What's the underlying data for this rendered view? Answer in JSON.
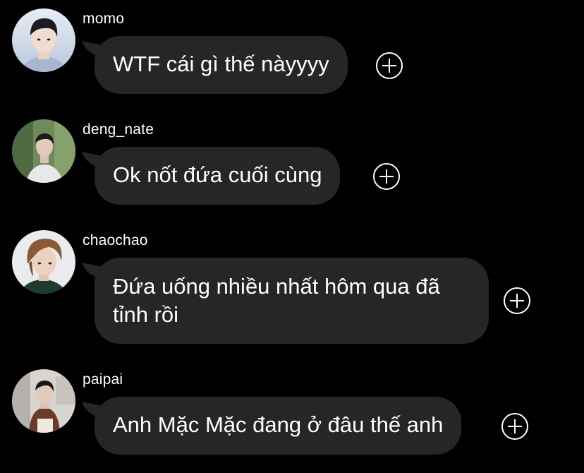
{
  "messages": [
    {
      "username": "momo",
      "text": "WTF cái gì thế nàyyyy",
      "avatar_icon": "avatar-photo-icon"
    },
    {
      "username": "deng_nate",
      "text": "Ok nốt đứa cuối cùng",
      "avatar_icon": "avatar-photo-icon"
    },
    {
      "username": "chaochao",
      "text_line1": "Đứa uống nhiều nhất hôm qua đã",
      "text_line2": "tỉnh rồi",
      "avatar_icon": "avatar-photo-icon"
    },
    {
      "username": "paipai",
      "text": "Anh Mặc Mặc đang ở đâu thế anh",
      "avatar_icon": "avatar-photo-icon"
    }
  ],
  "colors": {
    "background": "#000000",
    "bubble": "#262626",
    "text": "#ffffff"
  },
  "react_icon": "add-reaction-icon"
}
